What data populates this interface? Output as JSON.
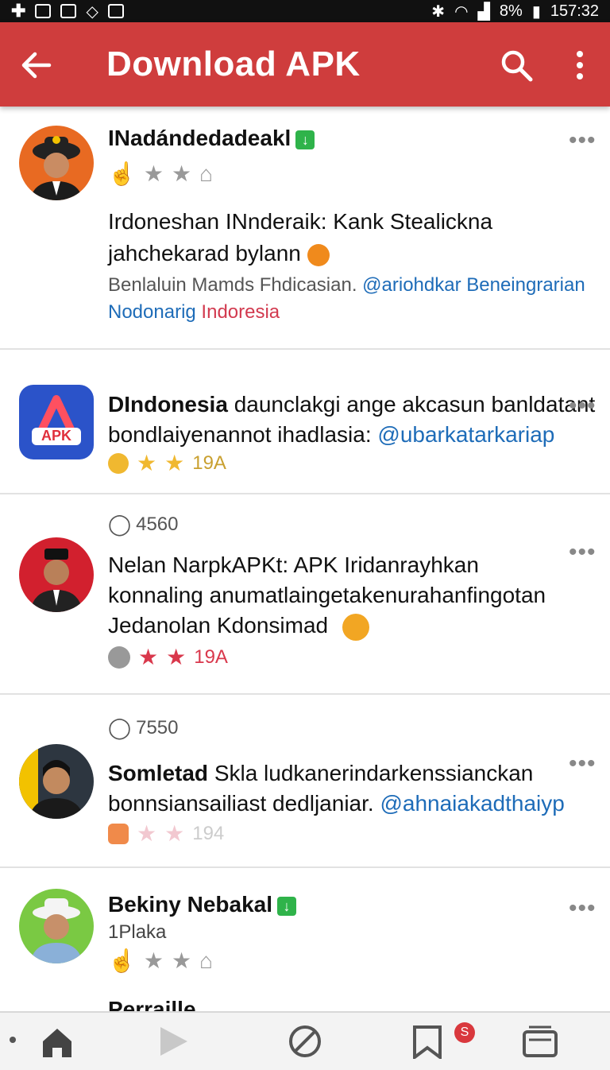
{
  "status_bar": {
    "battery": "8%",
    "time": "157:32"
  },
  "app_bar": {
    "title": "Download APK"
  },
  "posts": [
    {
      "name": "INadándedadeakl",
      "line1": "Irdoneshan INnderaik: Kank Stealickna",
      "line2": "jahchekarad bylann",
      "sub1": "Benlaluin Mamds Fhdicasian.",
      "sub1_link": "@ariohdkar Beneingrarian",
      "sub2_link": "Nodonarig",
      "sub2_red": "Indoresia"
    },
    {
      "name": "DIndonesia",
      "line1_rest": "daunclakgi ange akcasun banldatant",
      "line2": "bondlaiyenannot ihadlasia:",
      "line2_link": "@ubarkatarkariap",
      "rating": "19A",
      "logo_text": "APK"
    },
    {
      "count": "4560",
      "line1": "Nelan NarpkAPKt: APK Iridanrayhkan",
      "line2": "konnaling anumatlaingetakenurahanfingotan",
      "line3": "Jedanolan Kdonsimad",
      "rating": "19A"
    },
    {
      "count": "7550",
      "name": "Somletad",
      "line1_rest": "Skla ludkanerindarkenssianckan",
      "line2": "bonnsiansailiast dedljaniar.",
      "line2_link": "@ahnaiakadthaiyp",
      "rating": "194"
    },
    {
      "name": "Bekiny Nebakal",
      "handle": "1Plaka"
    }
  ],
  "peek_text": "Perraille",
  "bottom_nav": {
    "badge": "S"
  },
  "colors": {
    "accent": "#cf3d3d",
    "link": "#1e6cb8",
    "verified": "#2fb34a"
  }
}
